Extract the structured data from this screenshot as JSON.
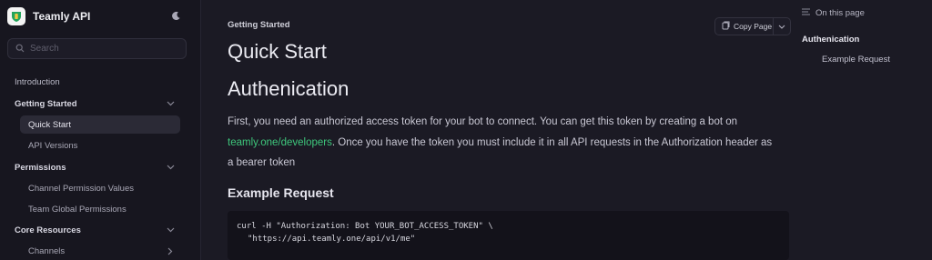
{
  "app": {
    "name": "Teamly API"
  },
  "search": {
    "placeholder": "Search"
  },
  "nav": {
    "introduction": "Introduction",
    "getting_started": "Getting Started",
    "quick_start": "Quick Start",
    "api_versions": "API Versions",
    "permissions": "Permissions",
    "channel_permission_values": "Channel Permission Values",
    "team_global_permissions": "Team Global Permissions",
    "core_resources": "Core Resources",
    "channels": "Channels"
  },
  "main": {
    "breadcrumb": "Getting Started",
    "copy_label": "Copy Page",
    "title": "Quick Start",
    "section_title": "Authenication",
    "paragraph_before_link": "First, you need an authorized access token for your bot to connect. You can get this token by creating a bot on ",
    "link_text": "teamly.one/developers",
    "paragraph_after_link": ". Once you have the token you must include it in all API requests in the Authorization header as a bearer token",
    "example_title": "Example Request",
    "code_line_1": "curl -H \"Authorization: Bot YOUR_BOT_ACCESS_TOKEN\" \\",
    "code_line_2": "\"https://api.teamly.one/api/v1/me\""
  },
  "toc": {
    "heading": "On this page",
    "items": [
      "Authenication",
      "Example Request"
    ]
  },
  "colors": {
    "background": "#1b1a24",
    "sidebar": "#17161f",
    "link": "#3ec77c",
    "active_nav": "#2b2a36"
  }
}
